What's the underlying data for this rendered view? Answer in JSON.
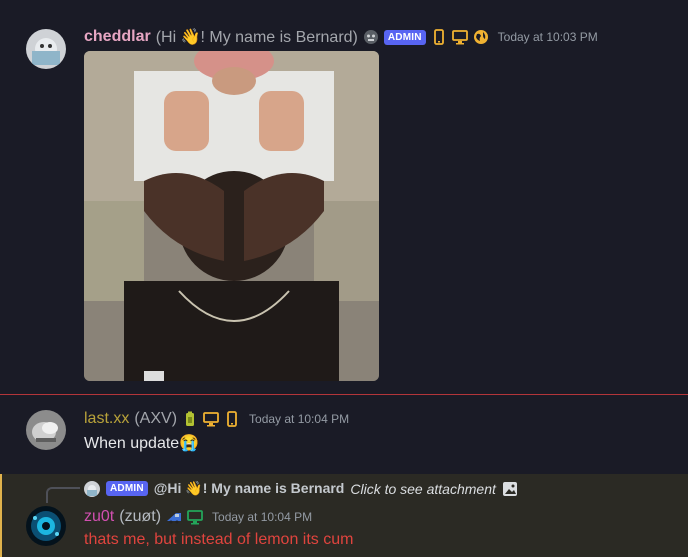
{
  "messages": [
    {
      "username": "cheddlar",
      "nickname": "(Hi 👋! My name is Bernard)",
      "badge": "ADMIN",
      "timestamp": "Today at 10:03 PM",
      "name_color": "#e7a6c3",
      "icons": [
        "monkey-emoji-icon",
        "phone-icon",
        "desktop-icon",
        "web-globe-icon"
      ]
    },
    {
      "username": "last.xx",
      "nickname": "(AXV)",
      "timestamp": "Today at 10:04 PM",
      "text": "When update😭",
      "name_color": "#b8a23a",
      "icons": [
        "battery-emoji-icon",
        "desktop-icon",
        "phone-icon"
      ]
    },
    {
      "reply_to": {
        "badge": "ADMIN",
        "nickname": "@Hi 👋! My name is Bernard",
        "attachment_text": "Click to see attachment"
      },
      "username": "zu0t",
      "nickname": "(zuøt)",
      "timestamp": "Today at 10:04 PM",
      "text": "thats me, but instead of lemon its cum",
      "name_color": "#d14fb0",
      "text_color": "#e0443e",
      "icons": [
        "train-emoji-icon",
        "desktop-icon"
      ]
    }
  ],
  "colors": {
    "background": "#1a1b26",
    "mention_highlight": "#2b2a24",
    "mention_bar": "#e0b24c",
    "admin_badge": "#5865f2",
    "status_icon": "#f0b232",
    "online_desktop": "#23a55a"
  }
}
